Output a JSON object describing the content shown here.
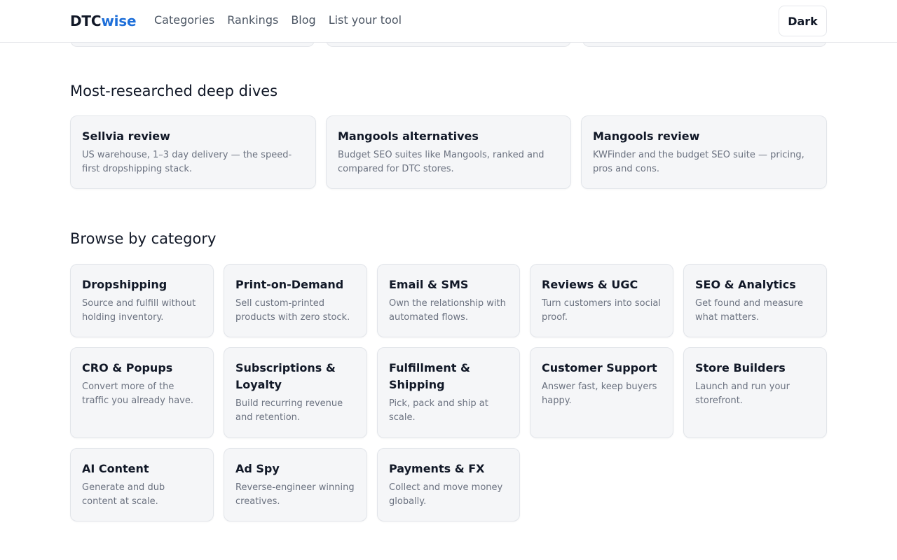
{
  "brand": {
    "part1": "DTC",
    "part2": "wise",
    "accent": "#1e6fd9"
  },
  "nav": {
    "items": [
      "Categories",
      "Rankings",
      "Blog",
      "List your tool"
    ]
  },
  "theme_toggle": {
    "label": "Dark"
  },
  "deep_dives": {
    "title": "Most-researched deep dives",
    "cards": [
      {
        "title": "Sellvia review",
        "desc": "US warehouse, 1–3 day delivery — the speed-first dropshipping stack."
      },
      {
        "title": "Mangools alternatives",
        "desc": "Budget SEO suites like Mangools, ranked and compared for DTC stores."
      },
      {
        "title": "Mangools review",
        "desc": "KWFinder and the budget SEO suite — pricing, pros and cons."
      }
    ]
  },
  "categories": {
    "title": "Browse by category",
    "cards": [
      {
        "title": "Dropshipping",
        "desc": "Source and fulfill without holding inventory."
      },
      {
        "title": "Print-on-Demand",
        "desc": "Sell custom-printed products with zero stock."
      },
      {
        "title": "Email & SMS",
        "desc": "Own the relationship with automated flows."
      },
      {
        "title": "Reviews & UGC",
        "desc": "Turn customers into social proof."
      },
      {
        "title": "SEO & Analytics",
        "desc": "Get found and measure what matters."
      },
      {
        "title": "CRO & Popups",
        "desc": "Convert more of the traffic you already have."
      },
      {
        "title": "Subscriptions & Loyalty",
        "desc": "Build recurring revenue and retention."
      },
      {
        "title": "Fulfillment & Shipping",
        "desc": "Pick, pack and ship at scale."
      },
      {
        "title": "Customer Support",
        "desc": "Answer fast, keep buyers happy."
      },
      {
        "title": "Store Builders",
        "desc": "Launch and run your storefront."
      },
      {
        "title": "AI Content",
        "desc": "Generate and dub content at scale."
      },
      {
        "title": "Ad Spy",
        "desc": "Reverse-engineer winning creatives."
      },
      {
        "title": "Payments & FX",
        "desc": "Collect and move money globally."
      }
    ]
  }
}
